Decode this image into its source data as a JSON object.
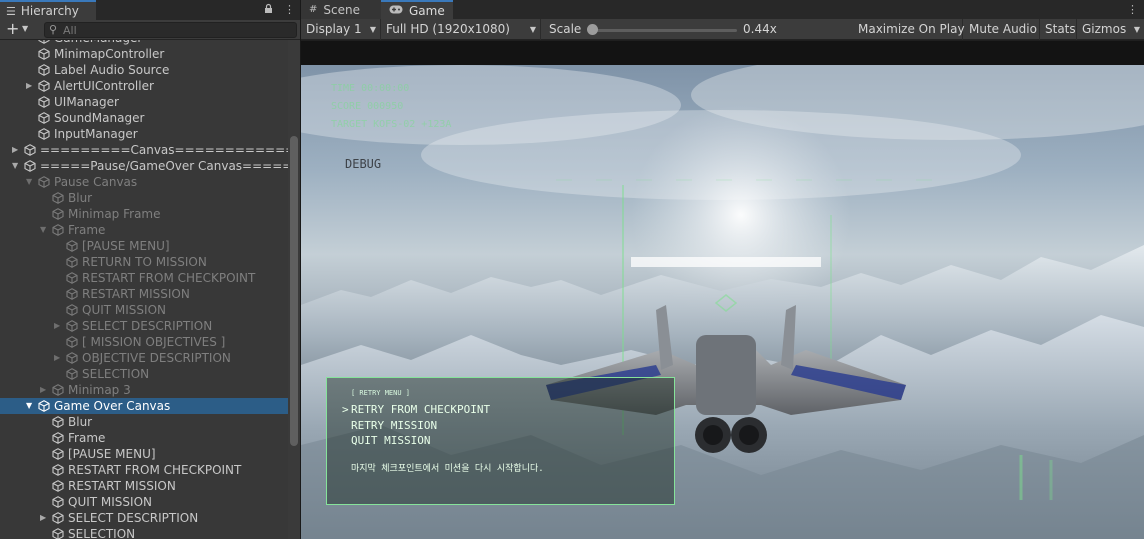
{
  "hierarchy": {
    "tab_label": "Hierarchy",
    "search_placeholder": "All",
    "rows": [
      {
        "name": "GameManager",
        "level": 3,
        "arrow": "",
        "dim": false,
        "selected": false
      },
      {
        "name": "MinimapController",
        "level": 3,
        "arrow": "",
        "dim": false,
        "selected": false
      },
      {
        "name": "Label Audio Source",
        "level": 3,
        "arrow": "",
        "dim": false,
        "selected": false
      },
      {
        "name": "AlertUIController",
        "level": 3,
        "arrow": "▶",
        "dim": false,
        "selected": false
      },
      {
        "name": "UIManager",
        "level": 3,
        "arrow": "",
        "dim": false,
        "selected": false
      },
      {
        "name": "SoundManager",
        "level": 3,
        "arrow": "",
        "dim": false,
        "selected": false
      },
      {
        "name": "InputManager",
        "level": 3,
        "arrow": "",
        "dim": false,
        "selected": false
      },
      {
        "name": "=========Canvas==============",
        "level": 2,
        "arrow": "▶",
        "dim": false,
        "selected": false
      },
      {
        "name": "=====Pause/GameOver Canvas======",
        "level": 2,
        "arrow": "▼",
        "dim": false,
        "selected": false
      },
      {
        "name": "Pause Canvas",
        "level": 3,
        "arrow": "▼",
        "dim": true,
        "selected": false
      },
      {
        "name": "Blur",
        "level": 4,
        "arrow": "",
        "dim": true,
        "selected": false
      },
      {
        "name": "Minimap Frame",
        "level": 4,
        "arrow": "",
        "dim": true,
        "selected": false
      },
      {
        "name": "Frame",
        "level": 4,
        "arrow": "▼",
        "dim": true,
        "selected": false
      },
      {
        "name": "[PAUSE MENU]",
        "level": 5,
        "arrow": "",
        "dim": true,
        "selected": false
      },
      {
        "name": "RETURN TO MISSION",
        "level": 5,
        "arrow": "",
        "dim": true,
        "selected": false
      },
      {
        "name": "RESTART FROM CHECKPOINT",
        "level": 5,
        "arrow": "",
        "dim": true,
        "selected": false
      },
      {
        "name": "RESTART MISSION",
        "level": 5,
        "arrow": "",
        "dim": true,
        "selected": false
      },
      {
        "name": "QUIT MISSION",
        "level": 5,
        "arrow": "",
        "dim": true,
        "selected": false
      },
      {
        "name": "SELECT DESCRIPTION",
        "level": 5,
        "arrow": "▶",
        "dim": true,
        "selected": false
      },
      {
        "name": "[ MISSION OBJECTIVES ]",
        "level": 5,
        "arrow": "",
        "dim": true,
        "selected": false
      },
      {
        "name": "OBJECTIVE DESCRIPTION",
        "level": 5,
        "arrow": "▶",
        "dim": true,
        "selected": false
      },
      {
        "name": "SELECTION",
        "level": 5,
        "arrow": "",
        "dim": true,
        "selected": false
      },
      {
        "name": "Minimap 3",
        "level": 4,
        "arrow": "▶",
        "dim": true,
        "selected": false
      },
      {
        "name": "Game Over Canvas",
        "level": 3,
        "arrow": "▼",
        "dim": false,
        "selected": true
      },
      {
        "name": "Blur",
        "level": 4,
        "arrow": "",
        "dim": false,
        "selected": false
      },
      {
        "name": "Frame",
        "level": 4,
        "arrow": "",
        "dim": false,
        "selected": false
      },
      {
        "name": "[PAUSE MENU]",
        "level": 4,
        "arrow": "",
        "dim": false,
        "selected": false
      },
      {
        "name": "RESTART FROM CHECKPOINT",
        "level": 4,
        "arrow": "",
        "dim": false,
        "selected": false
      },
      {
        "name": "RESTART MISSION",
        "level": 4,
        "arrow": "",
        "dim": false,
        "selected": false
      },
      {
        "name": "QUIT MISSION",
        "level": 4,
        "arrow": "",
        "dim": false,
        "selected": false
      },
      {
        "name": "SELECT DESCRIPTION",
        "level": 4,
        "arrow": "▶",
        "dim": false,
        "selected": false
      },
      {
        "name": "SELECTION",
        "level": 4,
        "arrow": "",
        "dim": false,
        "selected": false
      }
    ]
  },
  "game": {
    "tabs": {
      "scene": "Scene",
      "game": "Game"
    },
    "toolbar": {
      "display": "Display 1",
      "resolution": "Full HD (1920x1080)",
      "scale_label": "Scale",
      "scale_value": "0.44x",
      "maximize": "Maximize On Play",
      "mute": "Mute Audio",
      "stats": "Stats",
      "gizmos": "Gizmos"
    },
    "hud": {
      "time": "TIME 00:00:00",
      "score": "SCORE 000950",
      "target": "TARGET KOFS-02 +123A",
      "debug": "DEBUG"
    },
    "retry_menu": {
      "title": "[ RETRY MENU ]",
      "cursor": ">",
      "items": [
        "RETRY FROM CHECKPOINT",
        "RETRY MISSION",
        "QUIT MISSION"
      ],
      "description": "마지막 체크포인트에서 미션을 다시 시작합니다."
    }
  }
}
